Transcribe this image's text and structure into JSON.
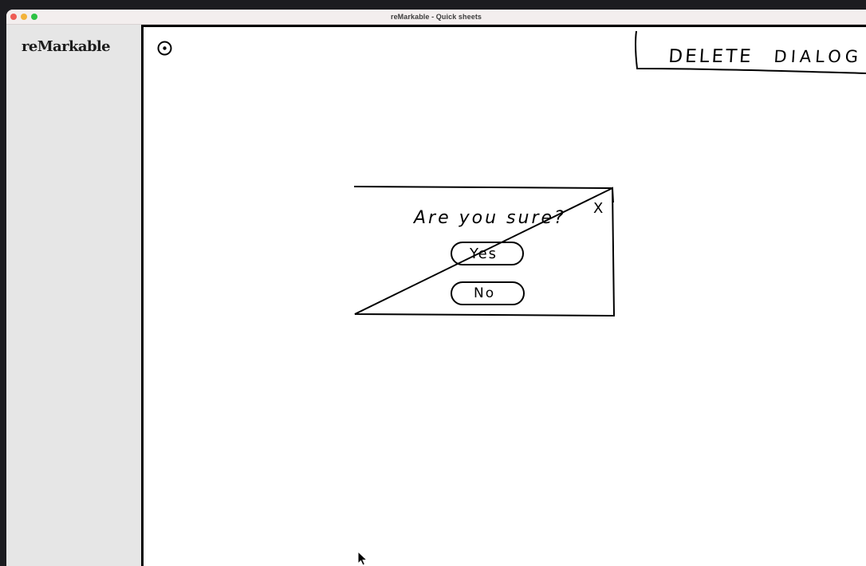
{
  "window": {
    "title": "reMarkable - Quick sheets"
  },
  "sidebar": {
    "brand": "reMarkable"
  },
  "canvas": {
    "tool_icon": "record-icon",
    "heading": "DELETE DIALOG",
    "heading_first_word": "DELETE",
    "heading_second_word": "DIALOG",
    "dialog": {
      "question": "Are you sure?",
      "close_label": "X",
      "yes_label": "Yes",
      "no_label": "No"
    }
  },
  "colors": {
    "close": "#ee5c55",
    "minimize": "#f3b33a",
    "maximize": "#2ec244",
    "sidebar": "#e6e6e6",
    "ink": "#000000"
  }
}
